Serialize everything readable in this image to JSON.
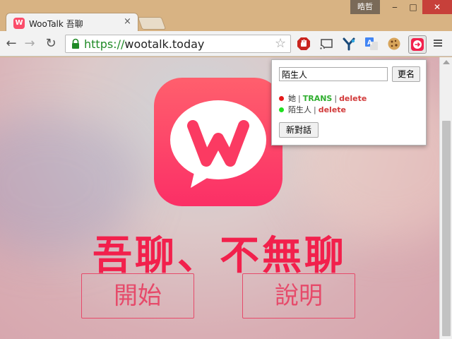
{
  "window": {
    "user_chip": "晧哲",
    "controls": {
      "minimize": "‒",
      "maximize": "□",
      "close": "✕"
    }
  },
  "tabs": [
    {
      "title": "WooTalk 吾聊",
      "favicon_letter": "W",
      "close": "×"
    }
  ],
  "toolbar": {
    "back": "←",
    "forward": "→",
    "reload": "↻",
    "url_scheme": "https://",
    "url_host": "wootalk.today",
    "star": "☆",
    "extensions": [
      "stop-icon",
      "cast-icon",
      "y-icon",
      "translate-icon",
      "cookie-icon",
      "wootalk-icon"
    ]
  },
  "page": {
    "slogan": "吾聊、不無聊",
    "start_button": "開始",
    "help_button": "說明",
    "logo_letter": "W"
  },
  "popup": {
    "nickname_value": "陌生人",
    "rename_button": "更名",
    "conversations": [
      {
        "status_color": "#e51a1a",
        "name": "她",
        "trans": "TRANS",
        "delete": "delete"
      },
      {
        "status_color": "#1fe01f",
        "name": "陌生人",
        "delete": "delete"
      }
    ],
    "new_conversation_button": "新對話"
  },
  "colors": {
    "brand_pink": "#fb4d6a",
    "slogan_red": "#f2204c",
    "link_green": "#2fae2f",
    "link_red": "#d23a3a"
  }
}
